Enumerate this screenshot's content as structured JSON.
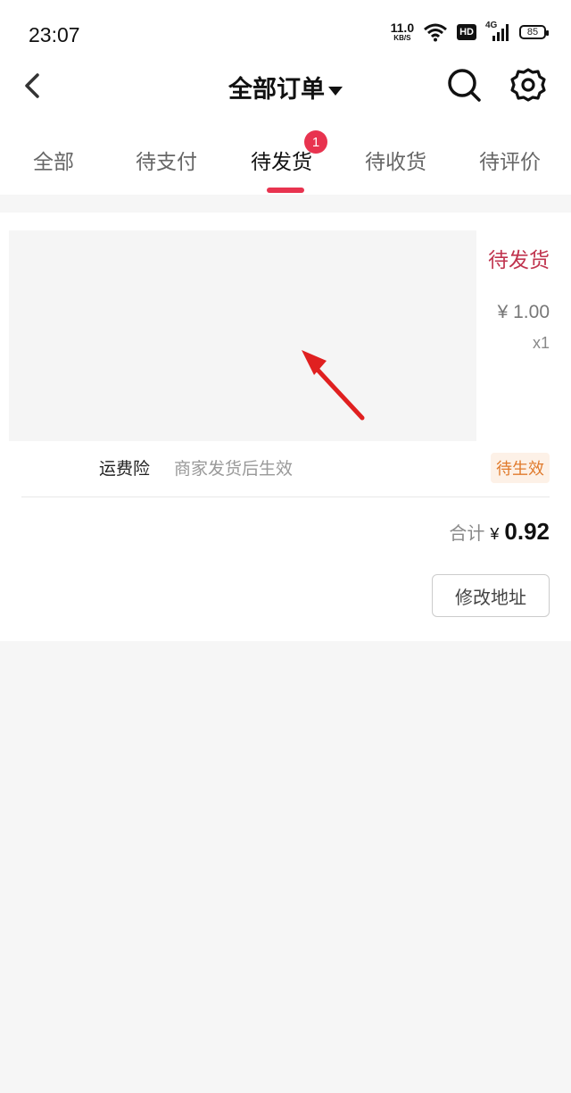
{
  "status_bar": {
    "time": "23:07",
    "net_speed": "11.0",
    "net_unit": "KB/S",
    "hd": "HD",
    "network": "4G",
    "battery": "85"
  },
  "header": {
    "title": "全部订单",
    "back_icon": "chevron-left-icon",
    "search_icon": "search-icon",
    "settings_icon": "gear-icon"
  },
  "tabs": [
    {
      "label": "全部"
    },
    {
      "label": "待支付"
    },
    {
      "label": "待发货",
      "active": true,
      "badge": "1"
    },
    {
      "label": "待收货"
    },
    {
      "label": "待评价"
    }
  ],
  "order": {
    "status": "待发货",
    "price": "¥ 1.00",
    "quantity": "x1",
    "insurance_label": "运费险",
    "insurance_desc": "商家发货后生效",
    "insurance_status": "待生效",
    "total_label": "合计",
    "total_currency": "¥",
    "total_amount": "0.92",
    "action_button": "修改地址"
  },
  "colors": {
    "accent": "#e8334f",
    "status_text": "#c0344f",
    "insurance_status": "#e07a2c",
    "background": "#f6f6f6"
  }
}
